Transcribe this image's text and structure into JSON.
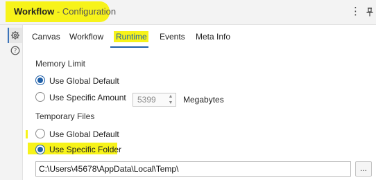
{
  "header": {
    "title_bold": "Workflow",
    "title_rest": " - Configuration",
    "menu_glyph": "⋮"
  },
  "sidebar": {
    "items": [
      {
        "icon": "gear-icon",
        "active": true
      },
      {
        "icon": "help-icon",
        "active": false
      }
    ]
  },
  "tabs": [
    {
      "label": "Canvas"
    },
    {
      "label": "Workflow"
    },
    {
      "label": "Runtime",
      "active": true
    },
    {
      "label": "Events"
    },
    {
      "label": "Meta Info"
    }
  ],
  "memory_limit": {
    "heading": "Memory Limit",
    "options": [
      {
        "label": "Use Global Default",
        "checked": true
      },
      {
        "label": "Use Specific Amount",
        "checked": false
      }
    ],
    "amount_value": "5399",
    "unit": "Megabytes"
  },
  "temporary_files": {
    "heading": "Temporary Files",
    "options": [
      {
        "label": "Use Global Default",
        "checked": false
      },
      {
        "label": "Use Specific Folder",
        "checked": true
      }
    ],
    "folder_path": "C:\\Users\\45678\\AppData\\Local\\Temp\\",
    "browse_label": "..."
  },
  "colors": {
    "accent": "#1f5fa8",
    "highlight": "#f7f31a"
  }
}
